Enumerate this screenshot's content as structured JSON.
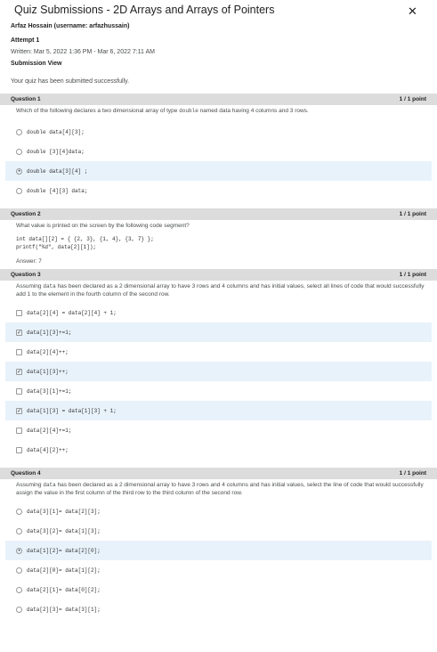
{
  "header": {
    "title": "Quiz Submissions - 2D Arrays and Arrays of Pointers",
    "close_glyph": "✕"
  },
  "meta": {
    "student": "Arfaz Hossain (username: arfazhussain)",
    "attempt": "Attempt 1",
    "written": "Written: Mar 5, 2022 1:36 PM - Mar 6, 2022 7:11 AM",
    "submission_view": "Submission View",
    "message": "Your quiz has been submitted successfully."
  },
  "q1": {
    "label": "Question 1",
    "score": "1 / 1 point",
    "text_pre": "Which of the following declares a two dimensional array of type ",
    "text_code": "double",
    "text_post": " named data having 4 columns and 3 rows.",
    "options": [
      "double data[4][3];",
      "double [3][4]data;",
      "double data[3][4] ;",
      "double [4][3] data;"
    ],
    "selected": 2
  },
  "q2": {
    "label": "Question 2",
    "score": "1 / 1 point",
    "text": "What value is printed on the screen by the following code segment?",
    "code_line1": "int data[][2] = { {2, 3}, {1, 4}, {3, 7} };",
    "code_line2": "printf(\"%d\", data[2][1]);",
    "answer": "Answer: 7"
  },
  "q3": {
    "label": "Question 3",
    "score": "1 / 1 point",
    "text_pre": "Assuming ",
    "text_code": "data",
    "text_post": " has been declared as a 2 dimensional array to have 3 rows and 4 columns and has initial values,  select all lines of code that would successfully add 1 to the element in the fourth column of the second row.",
    "options": [
      "data[2][4] = data[2][4] + 1;",
      "data[1][3]+=1;",
      "data[2][4]++;",
      "data[1][3]++;",
      "data[3][1]+=1;",
      "data[1][3] = data[1][3] + 1;",
      "data[2][4]+=1;",
      "data[4][2]++;"
    ],
    "checked": [
      1,
      3,
      5
    ]
  },
  "q4": {
    "label": "Question 4",
    "score": "1 / 1 point",
    "text_pre": "Assuming ",
    "text_code": "data",
    "text_post": " has been declared as a 2 dimensional array to have 3 rows and 4 columns and has initial values,  select the line of code that would successfully assign the value in the first column of the third row to the third column of the second row.",
    "options": [
      "data[3][1]= data[2][3];",
      "data[3][2]= data[1][3];",
      "data[1][2]= data[2][0];",
      "data[2][0]= data[1][2];",
      "data[2][1]= data[0][2];",
      "data[2][3]= data[3][1];"
    ],
    "selected": 2
  },
  "marks": {
    "radio_on": "•",
    "check_on": "✓"
  }
}
